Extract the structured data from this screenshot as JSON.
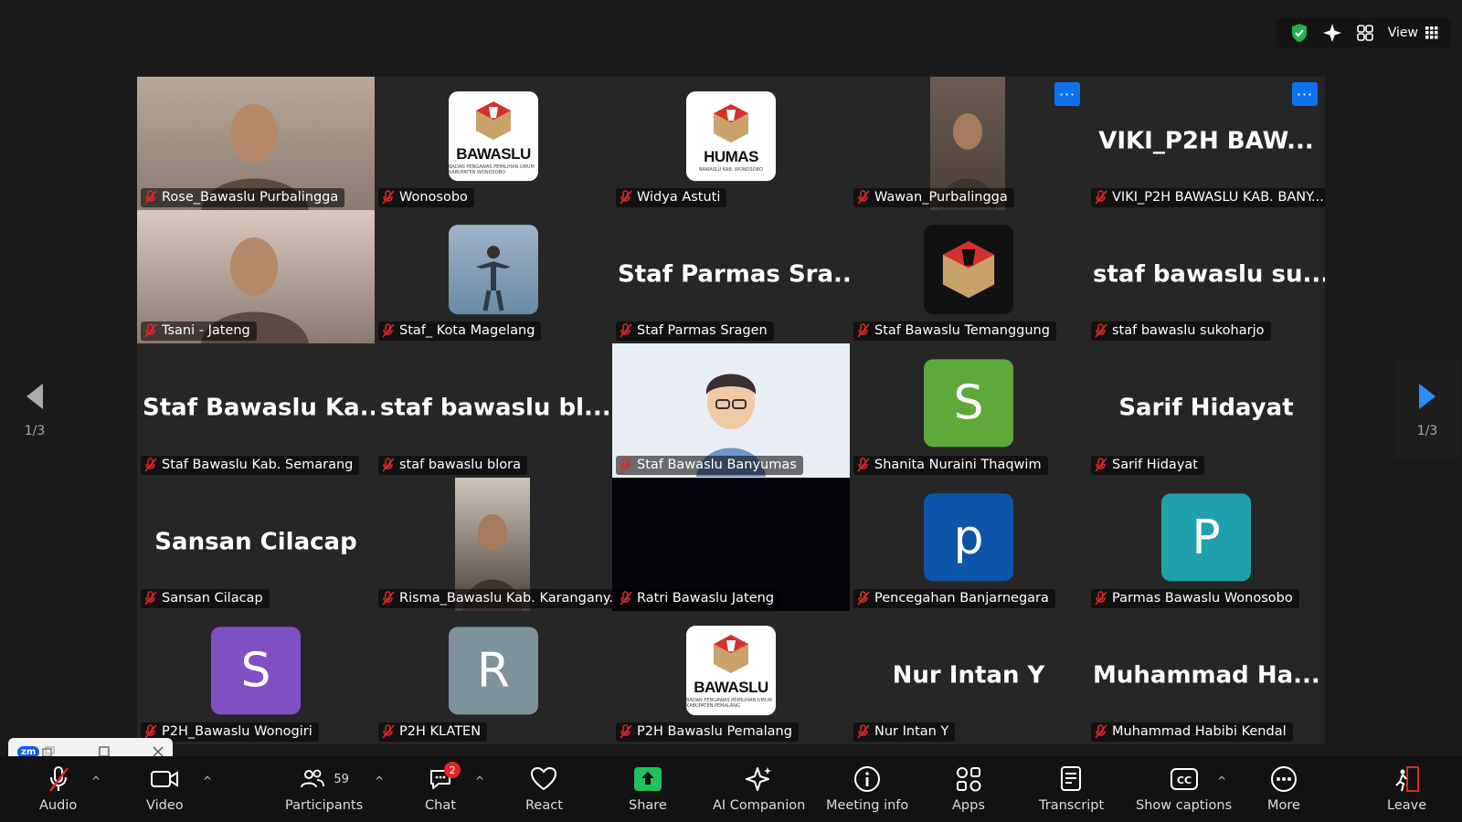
{
  "topbar": {
    "view_label": "View"
  },
  "participants": [
    {
      "name": "Rose_Bawaslu Purbalingga",
      "type": "photo",
      "tone": "#b9a99b"
    },
    {
      "name": "Wonosobo",
      "type": "logo",
      "logo_text": "BAWASLU",
      "logo_sub": "BADAN PENGAWAS PEMILIHAN UMUM KABUPATEN WONOSOBO"
    },
    {
      "name": "Widya Astuti",
      "type": "logo",
      "logo_text": "HUMAS",
      "logo_sub": "BAWASLU KAB. WONOSOBO"
    },
    {
      "name": "Wawan_Purbalingga",
      "type": "photo-narrow",
      "tone": "#6b5d52"
    },
    {
      "name": "VIKI_P2H BAWASLU KAB. BANY...",
      "type": "text",
      "big": "VIKI_P2H  BAW..."
    },
    {
      "name": "Tsani - Jateng",
      "type": "photo",
      "tone": "#d9c9bf",
      "active": true
    },
    {
      "name": "Staf_ Kota Magelang",
      "type": "photo-square",
      "tone": "#6b8aa5"
    },
    {
      "name": "Staf Parmas Sragen",
      "type": "text",
      "big": "Staf  Parmas  Sra..."
    },
    {
      "name": "Staf Bawaslu Temanggung",
      "type": "logo-dark"
    },
    {
      "name": "staf bawaslu sukoharjo",
      "type": "text",
      "big": "staf  bawaslu  su..."
    },
    {
      "name": "Staf Bawaslu Kab. Semarang",
      "type": "text",
      "big": "Staf  Bawaslu  Ka..."
    },
    {
      "name": "staf bawaslu blora",
      "type": "text",
      "big": "staf  bawaslu  bl..."
    },
    {
      "name": "Staf Bawaslu Banyumas",
      "type": "avatar3d"
    },
    {
      "name": "Shanita Nuraini Thaqwim",
      "type": "avatar",
      "letter": "S",
      "color": "#5fa83a"
    },
    {
      "name": "Sarif Hidayat",
      "type": "text",
      "big": "Sarif Hidayat"
    },
    {
      "name": "Sansan Cilacap",
      "type": "text",
      "big": "Sansan Cilacap"
    },
    {
      "name": "Risma_Bawaslu Kab. Karangany...",
      "type": "photo-narrow",
      "tone": "#cfc6ba"
    },
    {
      "name": "Ratri Bawaslu Jateng",
      "type": "black"
    },
    {
      "name": "Pencegahan Banjarnegara",
      "type": "avatar",
      "letter": "p",
      "color": "#0d55a8"
    },
    {
      "name": "Parmas Bawaslu Wonosobo",
      "type": "avatar",
      "letter": "P",
      "color": "#1fa1ad"
    },
    {
      "name": "P2H_Bawaslu Wonogiri",
      "type": "avatar",
      "letter": "S",
      "color": "#7f4fc5"
    },
    {
      "name": "P2H KLATEN",
      "type": "avatar",
      "letter": "R",
      "color": "#7d939b"
    },
    {
      "name": "P2H Bawaslu Pemalang",
      "type": "logo",
      "logo_text": "BAWASLU",
      "logo_sub": "BADAN PENGAWAS PEMILIHAN UMUM KABUPATEN PEMALANG"
    },
    {
      "name": "Nur Intan Y",
      "type": "text",
      "big": "Nur Intan Y"
    },
    {
      "name": "Muhammad Habibi Kendal",
      "type": "text",
      "big": "Muhammad  Ha..."
    }
  ],
  "pagination": {
    "left": "1/3",
    "right": "1/3"
  },
  "toolbar": {
    "audio": "Audio",
    "video": "Video",
    "participants": "Participants",
    "participants_count": "59",
    "chat": "Chat",
    "chat_badge": "2",
    "react": "React",
    "share": "Share",
    "ai_companion": "AI Companion",
    "meeting_info": "Meeting info",
    "apps": "Apps",
    "transcript": "Transcript",
    "show_captions": "Show captions",
    "more": "More",
    "leave": "Leave"
  },
  "colors": {
    "accent_blue": "#0e72ed",
    "active_speaker": "#2ecc71",
    "share_green": "#20c05c",
    "leave_red": "#e02828"
  }
}
